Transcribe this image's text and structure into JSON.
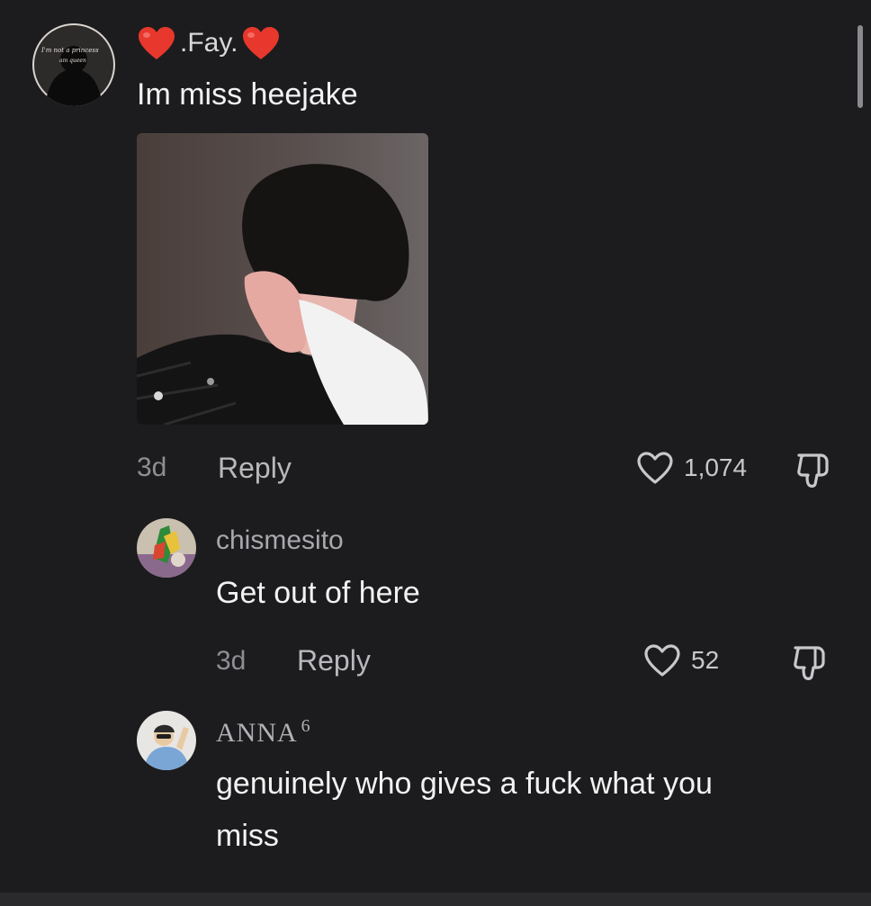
{
  "main_comment": {
    "username": ".Fay.",
    "avatar_text": [
      "I'm not a princess",
      "am queen"
    ],
    "text": "Im miss heejake",
    "time": "3d",
    "reply_label": "Reply",
    "likes": "1,074"
  },
  "replies": [
    {
      "username": "chismesito",
      "text": "Get out of here",
      "time": "3d",
      "reply_label": "Reply",
      "likes": "52"
    },
    {
      "username": "ANNA",
      "username_sup": "6",
      "text_line1": "genuinely who gives a fuck what you",
      "text_line2": "miss"
    }
  ],
  "colors": {
    "background": "#1c1c1e",
    "heart_emoji": "#e8372c",
    "text_primary": "#f2f2f2",
    "text_secondary": "#8e8e93"
  },
  "icons": {
    "like": "heart-outline-icon",
    "dislike": "thumbs-down-outline-icon",
    "username_decoration": "red-heart-emoji"
  }
}
